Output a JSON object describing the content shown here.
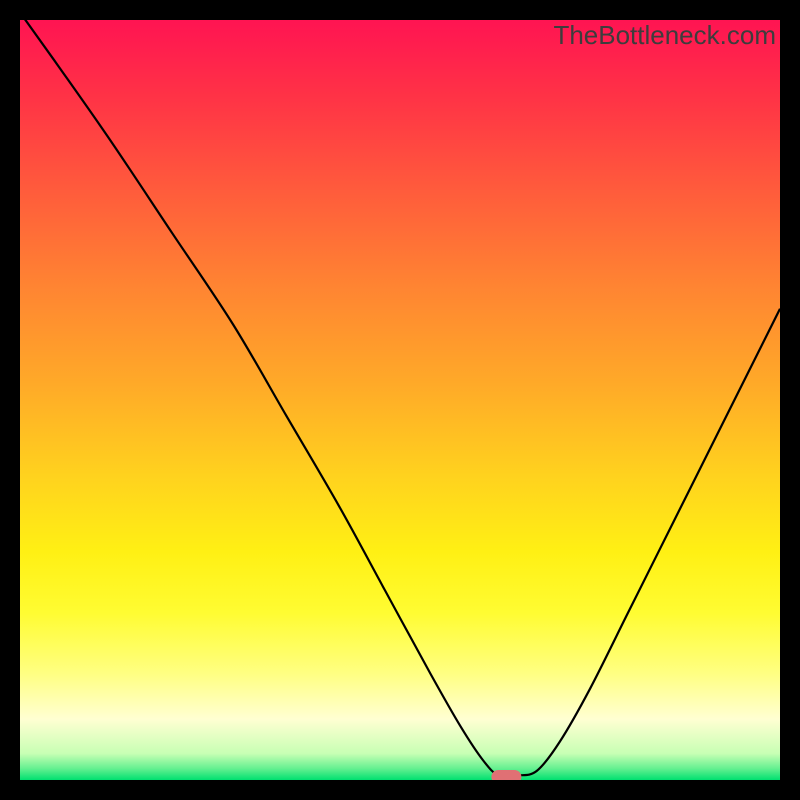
{
  "watermark": "TheBottleneck.com",
  "chart_data": {
    "type": "line",
    "title": "",
    "xlabel": "",
    "ylabel": "",
    "xlim": [
      0,
      100
    ],
    "ylim": [
      0,
      100
    ],
    "series": [
      {
        "name": "curve",
        "x": [
          0,
          5,
          12,
          20,
          28,
          35,
          42,
          48,
          54,
          58,
          61,
          63,
          65.5,
          68,
          71,
          75,
          80,
          86,
          92,
          100
        ],
        "values": [
          101,
          94,
          84,
          72,
          60,
          48,
          36,
          25,
          14,
          7,
          2.5,
          0.6,
          0.6,
          1.2,
          5,
          12,
          22,
          34,
          46,
          62
        ]
      }
    ],
    "marker": {
      "x": 64,
      "y": 0.4,
      "color": "#e07074"
    },
    "gradient_stops": [
      {
        "offset": 0.0,
        "color": "#ff1452"
      },
      {
        "offset": 0.1,
        "color": "#ff3246"
      },
      {
        "offset": 0.22,
        "color": "#ff5a3c"
      },
      {
        "offset": 0.35,
        "color": "#ff8432"
      },
      {
        "offset": 0.48,
        "color": "#ffaa28"
      },
      {
        "offset": 0.6,
        "color": "#ffd21e"
      },
      {
        "offset": 0.7,
        "color": "#fff014"
      },
      {
        "offset": 0.78,
        "color": "#fffc32"
      },
      {
        "offset": 0.86,
        "color": "#ffff82"
      },
      {
        "offset": 0.92,
        "color": "#ffffd2"
      },
      {
        "offset": 0.965,
        "color": "#c8ffb4"
      },
      {
        "offset": 0.985,
        "color": "#64f090"
      },
      {
        "offset": 1.0,
        "color": "#00e070"
      }
    ]
  }
}
